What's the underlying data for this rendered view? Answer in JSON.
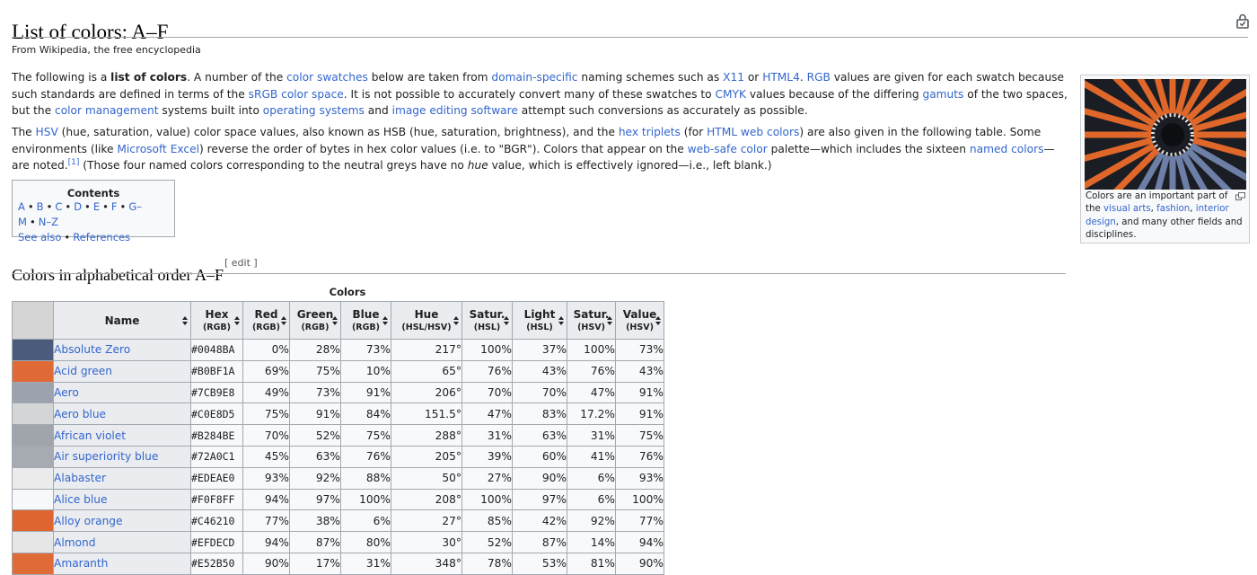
{
  "page": {
    "title": "List of colors: A–F",
    "tagline": "From Wikipedia, the free encyclopedia"
  },
  "intro": {
    "p1": [
      {
        "t": "The following is a "
      },
      {
        "t": "list of colors",
        "b": true
      },
      {
        "t": ". A number of the "
      },
      {
        "t": "color swatches",
        "l": true
      },
      {
        "t": " below are taken from "
      },
      {
        "t": "domain-specific",
        "l": true
      },
      {
        "t": " naming schemes such as "
      },
      {
        "t": "X11",
        "l": true
      },
      {
        "t": " or "
      },
      {
        "t": "HTML4",
        "l": true
      },
      {
        "t": ". "
      },
      {
        "t": "RGB",
        "l": true
      },
      {
        "t": " values are given for each swatch because such standards are defined in terms of the "
      },
      {
        "t": "sRGB color space",
        "l": true
      },
      {
        "t": ". It is not possible to accurately convert many of these swatches to "
      },
      {
        "t": "CMYK",
        "l": true
      },
      {
        "t": " values because of the differing "
      },
      {
        "t": "gamuts",
        "l": true
      },
      {
        "t": " of the two spaces, but the "
      },
      {
        "t": "color management",
        "l": true
      },
      {
        "t": " systems built into "
      },
      {
        "t": "operating systems",
        "l": true
      },
      {
        "t": " and "
      },
      {
        "t": "image editing software",
        "l": true
      },
      {
        "t": " attempt such conversions as accurately as possible."
      }
    ],
    "p2": [
      {
        "t": "The "
      },
      {
        "t": "HSV",
        "l": true
      },
      {
        "t": " (hue, saturation, value) color space values, also known as HSB (hue, saturation, brightness), and the "
      },
      {
        "t": "hex triplets",
        "l": true
      },
      {
        "t": " (for "
      },
      {
        "t": "HTML web colors",
        "l": true
      },
      {
        "t": ") are also given in the following table. Some environments (like "
      },
      {
        "t": "Microsoft Excel",
        "l": true
      },
      {
        "t": ") reverse the order of bytes in hex color values (i.e. to \"BGR\"). Colors that appear on the "
      },
      {
        "t": "web-safe color",
        "l": true
      },
      {
        "t": " palette—which includes the sixteen "
      },
      {
        "t": "named colors",
        "l": true
      },
      {
        "t": "—are noted."
      },
      {
        "t": "[1]",
        "l": true,
        "sup": true
      },
      {
        "t": " (Those four named colors corresponding to the neutral greys have no "
      },
      {
        "t": "hue",
        "i": true
      },
      {
        "t": " value, which is effectively ignored—i.e., left blank.)"
      }
    ]
  },
  "toc": {
    "title": "Contents",
    "row1": [
      "A",
      "B",
      "C",
      "D",
      "E",
      "F",
      "G–M",
      "N–Z"
    ],
    "row2": [
      "See also",
      "References"
    ]
  },
  "thumb": {
    "caption": [
      {
        "t": "Colors are an important part of the "
      },
      {
        "t": "visual arts",
        "l": true
      },
      {
        "t": ", "
      },
      {
        "t": "fashion",
        "l": true
      },
      {
        "t": ", "
      },
      {
        "t": "interior design",
        "l": true
      },
      {
        "t": ", and many other fields and disciplines."
      }
    ],
    "image_colors": [
      "#e0672a",
      "#1b1d24",
      "#6d7fa6"
    ]
  },
  "section": {
    "heading": "Colors in alphabetical order A–F",
    "edit_label": "[ edit ]"
  },
  "table": {
    "caption": "Colors",
    "headers": [
      {
        "main": "Name",
        "sub": ""
      },
      {
        "main": "Hex",
        "sub": "(RGB)"
      },
      {
        "main": "Red",
        "sub": "(RGB)"
      },
      {
        "main": "Green",
        "sub": "(RGB)"
      },
      {
        "main": "Blue",
        "sub": "(RGB)"
      },
      {
        "main": "Hue",
        "sub": "(HSL/HSV)"
      },
      {
        "main": "Satur.",
        "sub": "(HSL)"
      },
      {
        "main": "Light",
        "sub": "(HSL)"
      },
      {
        "main": "Satur.",
        "sub": "(HSV)"
      },
      {
        "main": "Value",
        "sub": "(HSV)"
      }
    ],
    "rows": [
      {
        "swatch": "#4a5b7c",
        "name": "Absolute Zero",
        "hex": "#0048BA",
        "red": "0%",
        "green": "28%",
        "blue": "73%",
        "hue": "217°",
        "sat_hsl": "100%",
        "light": "37%",
        "sat_hsv": "100%",
        "value": "73%"
      },
      {
        "swatch": "#df6a35",
        "name": "Acid green",
        "hex": "#B0BF1A",
        "red": "69%",
        "green": "75%",
        "blue": "10%",
        "hue": "65°",
        "sat_hsl": "76%",
        "light": "43%",
        "sat_hsv": "76%",
        "value": "43%"
      },
      {
        "swatch": "#9ca3ae",
        "name": "Aero",
        "hex": "#7CB9E8",
        "red": "49%",
        "green": "73%",
        "blue": "91%",
        "hue": "206°",
        "sat_hsl": "70%",
        "light": "70%",
        "sat_hsv": "47%",
        "value": "91%"
      },
      {
        "swatch": "#d3d5d7",
        "name": "Aero blue",
        "hex": "#C0E8D5",
        "red": "75%",
        "green": "91%",
        "blue": "84%",
        "hue": "151.5°",
        "sat_hsl": "47%",
        "light": "83%",
        "sat_hsv": "17.2%",
        "value": "91%"
      },
      {
        "swatch": "#a0a4ab",
        "name": "African violet",
        "hex": "#B284BE",
        "red": "70%",
        "green": "52%",
        "blue": "75%",
        "hue": "288°",
        "sat_hsl": "31%",
        "light": "63%",
        "sat_hsv": "31%",
        "value": "75%"
      },
      {
        "swatch": "#a6abb2",
        "name": "Air superiority blue",
        "hex": "#72A0C1",
        "red": "45%",
        "green": "63%",
        "blue": "76%",
        "hue": "205°",
        "sat_hsl": "39%",
        "light": "60%",
        "sat_hsv": "41%",
        "value": "76%"
      },
      {
        "swatch": "#ebebeb",
        "name": "Alabaster",
        "hex": "#EDEAE0",
        "red": "93%",
        "green": "92%",
        "blue": "88%",
        "hue": "50°",
        "sat_hsl": "27%",
        "light": "90%",
        "sat_hsv": "6%",
        "value": "93%"
      },
      {
        "swatch": "#f7f8fa",
        "name": "Alice blue",
        "hex": "#F0F8FF",
        "red": "94%",
        "green": "97%",
        "blue": "100%",
        "hue": "208°",
        "sat_hsl": "100%",
        "light": "97%",
        "sat_hsv": "6%",
        "value": "100%"
      },
      {
        "swatch": "#de6530",
        "name": "Alloy orange",
        "hex": "#C46210",
        "red": "77%",
        "green": "38%",
        "blue": "6%",
        "hue": "27°",
        "sat_hsl": "85%",
        "light": "42%",
        "sat_hsv": "92%",
        "value": "77%"
      },
      {
        "swatch": "#e6e6e6",
        "name": "Almond",
        "hex": "#EFDECD",
        "red": "94%",
        "green": "87%",
        "blue": "80%",
        "hue": "30°",
        "sat_hsl": "52%",
        "light": "87%",
        "sat_hsv": "14%",
        "value": "94%"
      },
      {
        "swatch": "#e16b36",
        "name": "Amaranth",
        "hex": "#E52B50",
        "red": "90%",
        "green": "17%",
        "blue": "31%",
        "hue": "348°",
        "sat_hsl": "78%",
        "light": "53%",
        "sat_hsv": "81%",
        "value": "90%"
      }
    ]
  }
}
